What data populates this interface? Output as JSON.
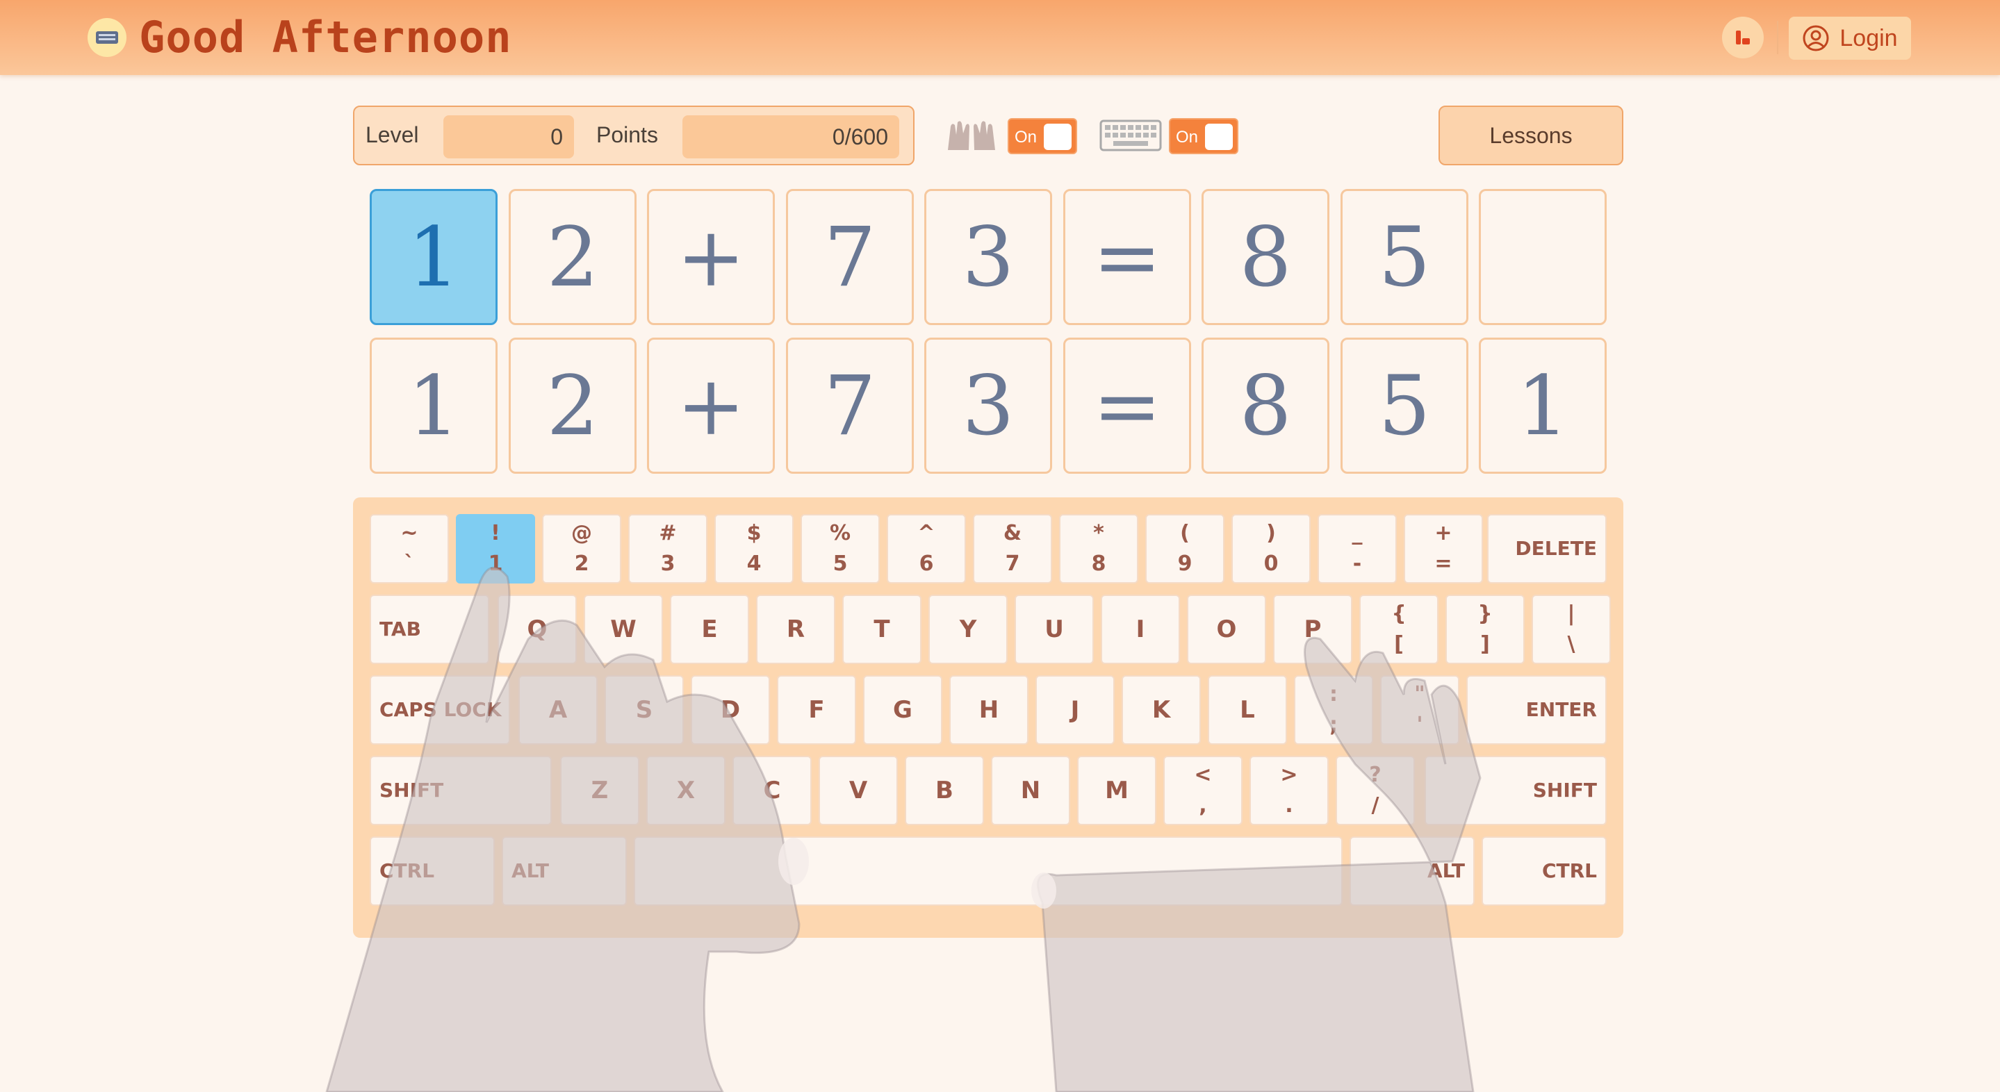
{
  "header": {
    "title": "Good Afternoon",
    "login_label": "Login"
  },
  "stats": {
    "level_label": "Level",
    "level_value": "0",
    "points_label": "Points",
    "points_value": "0/600"
  },
  "toggles": {
    "hands_toggle_label": "On",
    "keyboard_toggle_label": "On"
  },
  "lessons_label": "Lessons",
  "equation": {
    "target": [
      "1",
      "2",
      "+",
      "7",
      "3",
      "=",
      "8",
      "5",
      ""
    ],
    "answer": [
      "1",
      "2",
      "+",
      "7",
      "3",
      "=",
      "8",
      "5",
      "1"
    ],
    "active_index": 0
  },
  "keyboard": {
    "highlighted_key": "1",
    "row1": [
      {
        "top": "~",
        "bottom": "`"
      },
      {
        "top": "!",
        "bottom": "1"
      },
      {
        "top": "@",
        "bottom": "2"
      },
      {
        "top": "#",
        "bottom": "3"
      },
      {
        "top": "$",
        "bottom": "4"
      },
      {
        "top": "%",
        "bottom": "5"
      },
      {
        "top": "^",
        "bottom": "6"
      },
      {
        "top": "&",
        "bottom": "7"
      },
      {
        "top": "*",
        "bottom": "8"
      },
      {
        "top": "(",
        "bottom": "9"
      },
      {
        "top": ")",
        "bottom": "0"
      },
      {
        "top": "_",
        "bottom": "-"
      },
      {
        "top": "+",
        "bottom": "="
      }
    ],
    "delete": "DELETE",
    "tab": "TAB",
    "row2": [
      "Q",
      "W",
      "E",
      "R",
      "T",
      "Y",
      "U",
      "I",
      "O",
      "P"
    ],
    "row2_sym": [
      {
        "top": "{",
        "bottom": "["
      },
      {
        "top": "}",
        "bottom": "]"
      },
      {
        "top": "|",
        "bottom": "\\"
      }
    ],
    "caps": "CAPS LOCK",
    "row3": [
      "A",
      "S",
      "D",
      "F",
      "G",
      "H",
      "J",
      "K",
      "L"
    ],
    "row3_sym": [
      {
        "top": ":",
        "bottom": ";"
      },
      {
        "top": "\"",
        "bottom": "'"
      }
    ],
    "enter": "ENTER",
    "shift_left": "SHIFT",
    "row4": [
      "Z",
      "X",
      "C",
      "V",
      "B",
      "N",
      "M"
    ],
    "row4_sym": [
      {
        "top": "<",
        "bottom": ","
      },
      {
        "top": ">",
        "bottom": "."
      },
      {
        "top": "?",
        "bottom": "/"
      }
    ],
    "shift_right": "SHIFT",
    "ctrl_left": "CTRL",
    "alt_left": "ALT",
    "alt_right": "ALT",
    "ctrl_right": "CTRL"
  },
  "colors": {
    "accent": "#f4823c",
    "title": "#b9421c",
    "active_tile": "#8ed2f0",
    "highlight_key": "#7fcdf2"
  },
  "icons": [
    "keyboard-logo-icon",
    "brand-icon",
    "user-circle-icon",
    "hands-icon",
    "keyboard-icon"
  ]
}
